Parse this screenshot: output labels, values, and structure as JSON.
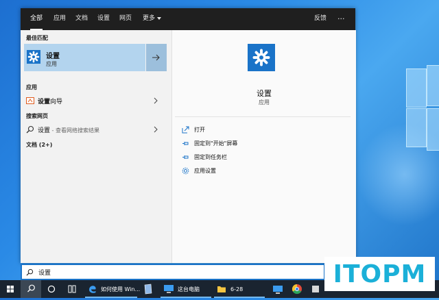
{
  "tabs": [
    {
      "label": "全部",
      "active": true
    },
    {
      "label": "应用"
    },
    {
      "label": "文档"
    },
    {
      "label": "设置"
    },
    {
      "label": "网页"
    }
  ],
  "tab_more": "更多",
  "feedback": "反馈",
  "more_dots": "···",
  "sections": {
    "best_match": "最佳匹配",
    "apps": "应用",
    "web": "搜索网页",
    "docs": "文档 (2+)"
  },
  "best_match": {
    "title": "设置",
    "subtitle": "应用"
  },
  "app_result": {
    "bold": "设置",
    "rest": "向导"
  },
  "web_result": {
    "bold": "设置",
    "rest": " - 查看网络搜索结果"
  },
  "preview": {
    "title": "设置",
    "subtitle": "应用"
  },
  "actions": [
    {
      "label": "打开",
      "icon": "open-icon"
    },
    {
      "label": "固定到\"开始\"屏幕",
      "icon": "pin-icon"
    },
    {
      "label": "固定到任务栏",
      "icon": "pin-icon"
    },
    {
      "label": "应用设置",
      "icon": "gear-icon"
    }
  ],
  "search": {
    "value": "设置"
  },
  "watermark": "ITOPM",
  "taskbar": {
    "edge_label": "如何使用 Win...",
    "pc_label": "这台电脑",
    "folder_label": "6-28"
  },
  "colors": {
    "accent": "#1a73c8",
    "highlight": "#b3d4ee",
    "taskbar": "#1a2430"
  }
}
